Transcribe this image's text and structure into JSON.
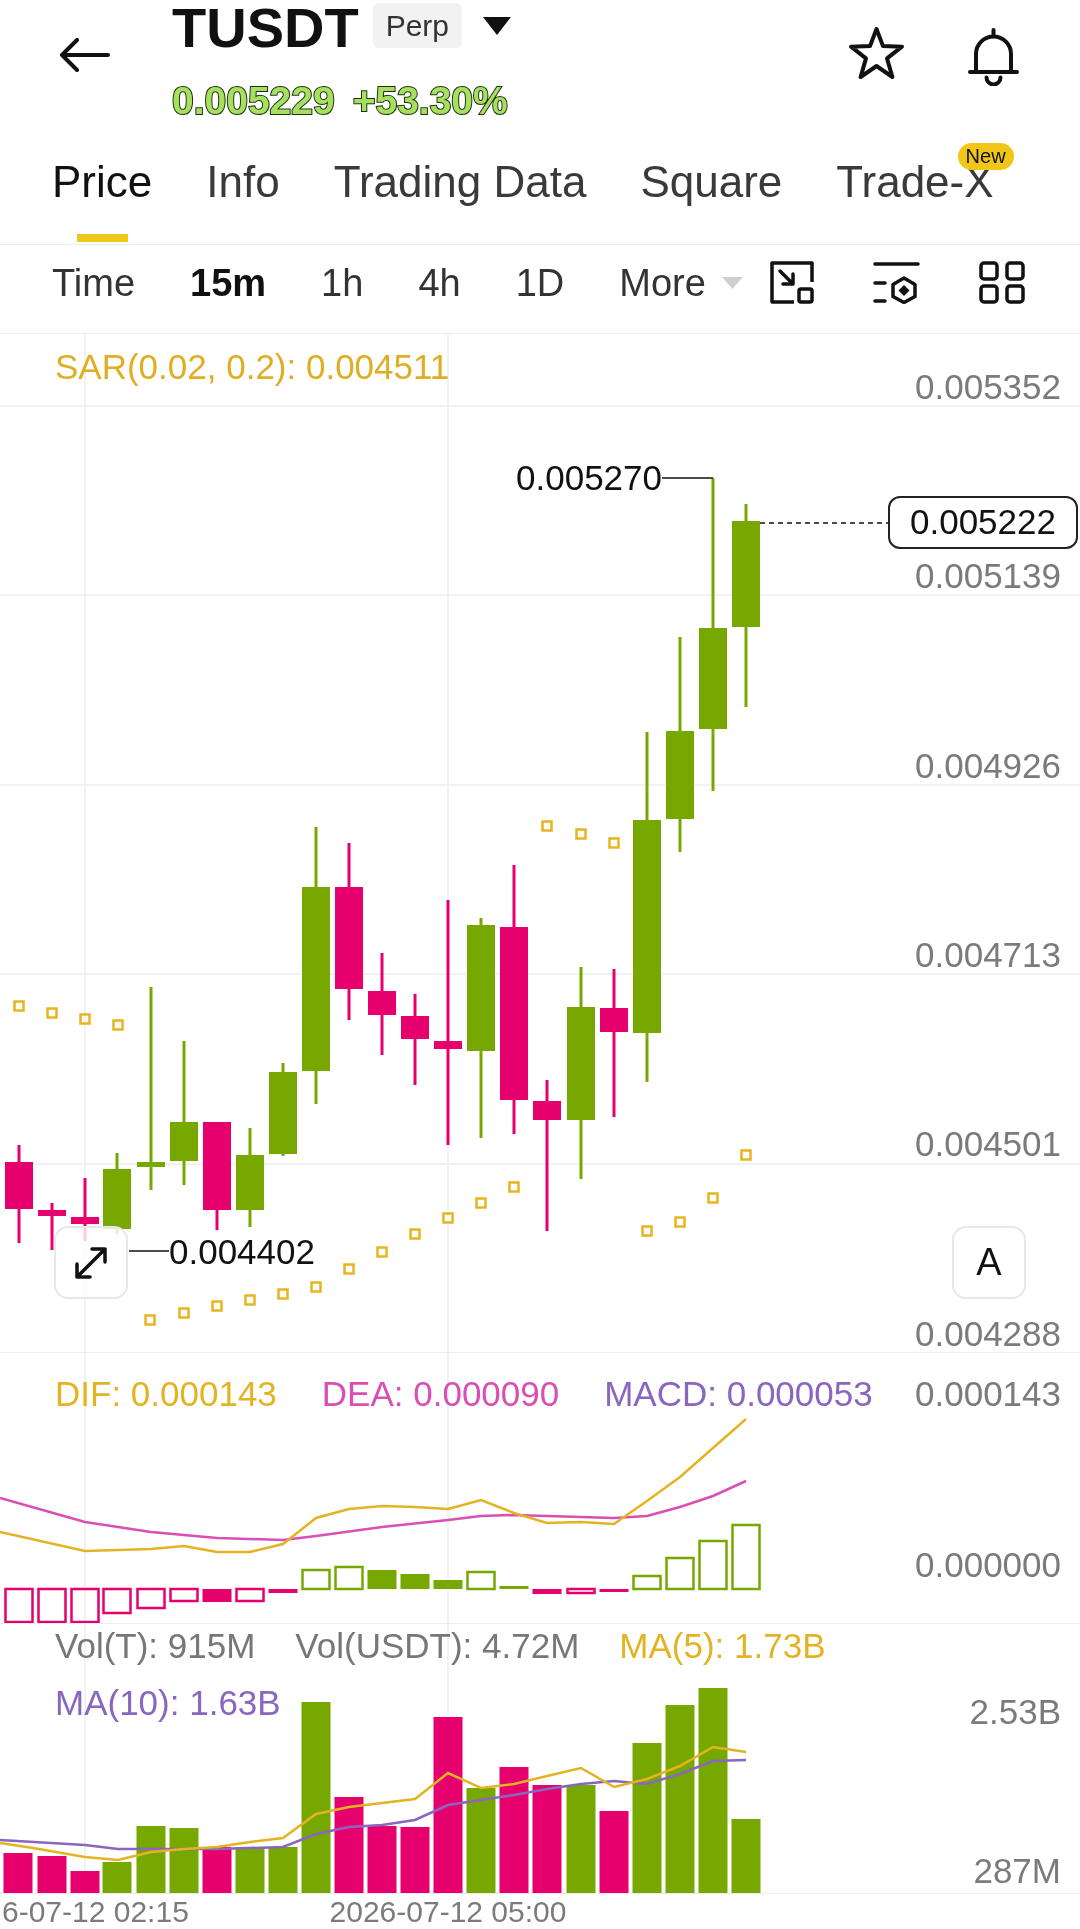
{
  "header": {
    "symbol": "TUSDT",
    "contract_badge": "Perp",
    "last_price": "0.005229",
    "change": "+53.30%"
  },
  "tabs": [
    {
      "label": "Price",
      "selected": true
    },
    {
      "label": "Info",
      "selected": false
    },
    {
      "label": "Trading Data",
      "selected": false
    },
    {
      "label": "Square",
      "selected": false
    },
    {
      "label": "Trade-X",
      "selected": false,
      "badge": "New"
    }
  ],
  "intervals": [
    {
      "label": "Time",
      "selected": false
    },
    {
      "label": "15m",
      "selected": true
    },
    {
      "label": "1h",
      "selected": false
    },
    {
      "label": "4h",
      "selected": false
    },
    {
      "label": "1D",
      "selected": false
    }
  ],
  "more_button": {
    "label": "More"
  },
  "price_chart": {
    "indicator": "SAR(0.02, 0.2): 0.004511",
    "axis_labels": [
      "0.005352",
      "0.005139",
      "0.004926",
      "0.004713",
      "0.004501",
      "0.004288"
    ],
    "high_label": "0.005270",
    "current_price": "0.005222",
    "low_label": "0.004402",
    "scale_button": "A"
  },
  "macd_chart": {
    "legend": [
      {
        "text": "DIF: 0.000143",
        "color": "#e4b324"
      },
      {
        "text": "DEA: 0.000090",
        "color": "#d94fb3"
      },
      {
        "text": "MACD: 0.000053",
        "color": "#8a66bf"
      }
    ],
    "axis_labels": [
      "0.000143",
      "0.000000"
    ]
  },
  "volume_chart": {
    "legend": [
      {
        "text": "Vol(T): 915M",
        "color": "#777777"
      },
      {
        "text": "Vol(USDT): 4.72M",
        "color": "#777777"
      },
      {
        "text": "MA(5): 1.73B",
        "color": "#e4b324"
      },
      {
        "text": "MA(10): 1.63B",
        "color": "#8a66bf"
      }
    ],
    "axis_labels": [
      "2.53B",
      "287M"
    ]
  },
  "time_axis": [
    "6-07-12 02:15",
    "2026-07-12 05:00"
  ]
}
